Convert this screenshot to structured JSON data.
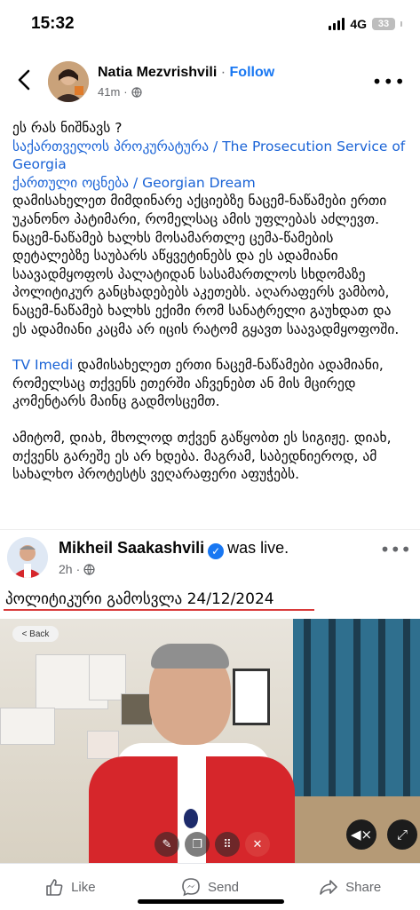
{
  "status_bar": {
    "time": "15:32",
    "network": "4G",
    "battery": "33"
  },
  "post": {
    "author": "Natia Mezvrishvili",
    "separator": "·",
    "follow_label": "Follow",
    "time": "41m",
    "privacy_separator": "·",
    "lines": [
      {
        "text": "ეს რას ნიშნავს ?",
        "link": false
      },
      {
        "text": "საქართველოს პროკურატურა / The Prosecution Service of Georgia",
        "link": true
      },
      {
        "text": "ქართული ოცნება / Georgian Dream",
        "link": true
      }
    ],
    "paragraph1": "დამისახელეთ მიმდინარე აქციებზე ნაცემ-ნაწამები ერთი უკანონო პატიმარი, რომელსაც ამის უფლებას აძლევთ. ნაცემ-ნაწამებ ხალხს მოსამართლე ცემა-წამების დეტალებზე საუბარს აწყვეტინებს და ეს ადამიანი საავადმყოფოს პალატიდან სასამართლოს სხდომაზე პოლიტიკურ განცხადებებს აკეთებს. აღარაფერს ვამბობ, ნაცემ-ნაწამებ ხალხს ექიმი რომ სანატრელი გაუხდათ და ეს ადამიანი კაცმა არ იცის რატომ გყავთ საავადმყოფოში.",
    "paragraph2_link": "TV Imedi",
    "paragraph2": " დამისახელეთ ერთი ნაცემ-ნაწამები ადამიანი, რომელსაც თქვენს ეთერში აჩვენებთ ან მის მცირედ კომენტარს მაინც გადმოსცემთ.",
    "paragraph3": "ამიტომ, დიახ, მხოლოდ თქვენ გაწყობთ ეს სიგიჟე. დიახ, თქვენს გარეშე ეს არ ხდება. მაგრამ, საბედნიეროდ, ამ სახალხო პროტესტს ვეღარაფერი აფუჭებს."
  },
  "shared": {
    "author": "Mikheil Saakashvili",
    "verified_glyph": "✓",
    "status": "was live.",
    "time": "2h",
    "separator": "·",
    "live_title": "პოლიტიკური გამოსვლა 24/12/2024",
    "video_back_chip": "< Back"
  },
  "actions": {
    "like": "Like",
    "send": "Send",
    "share": "Share"
  },
  "colors": {
    "accent": "#1877f2",
    "live_underline": "#d93a3a",
    "end_call": "#d93a3a"
  }
}
